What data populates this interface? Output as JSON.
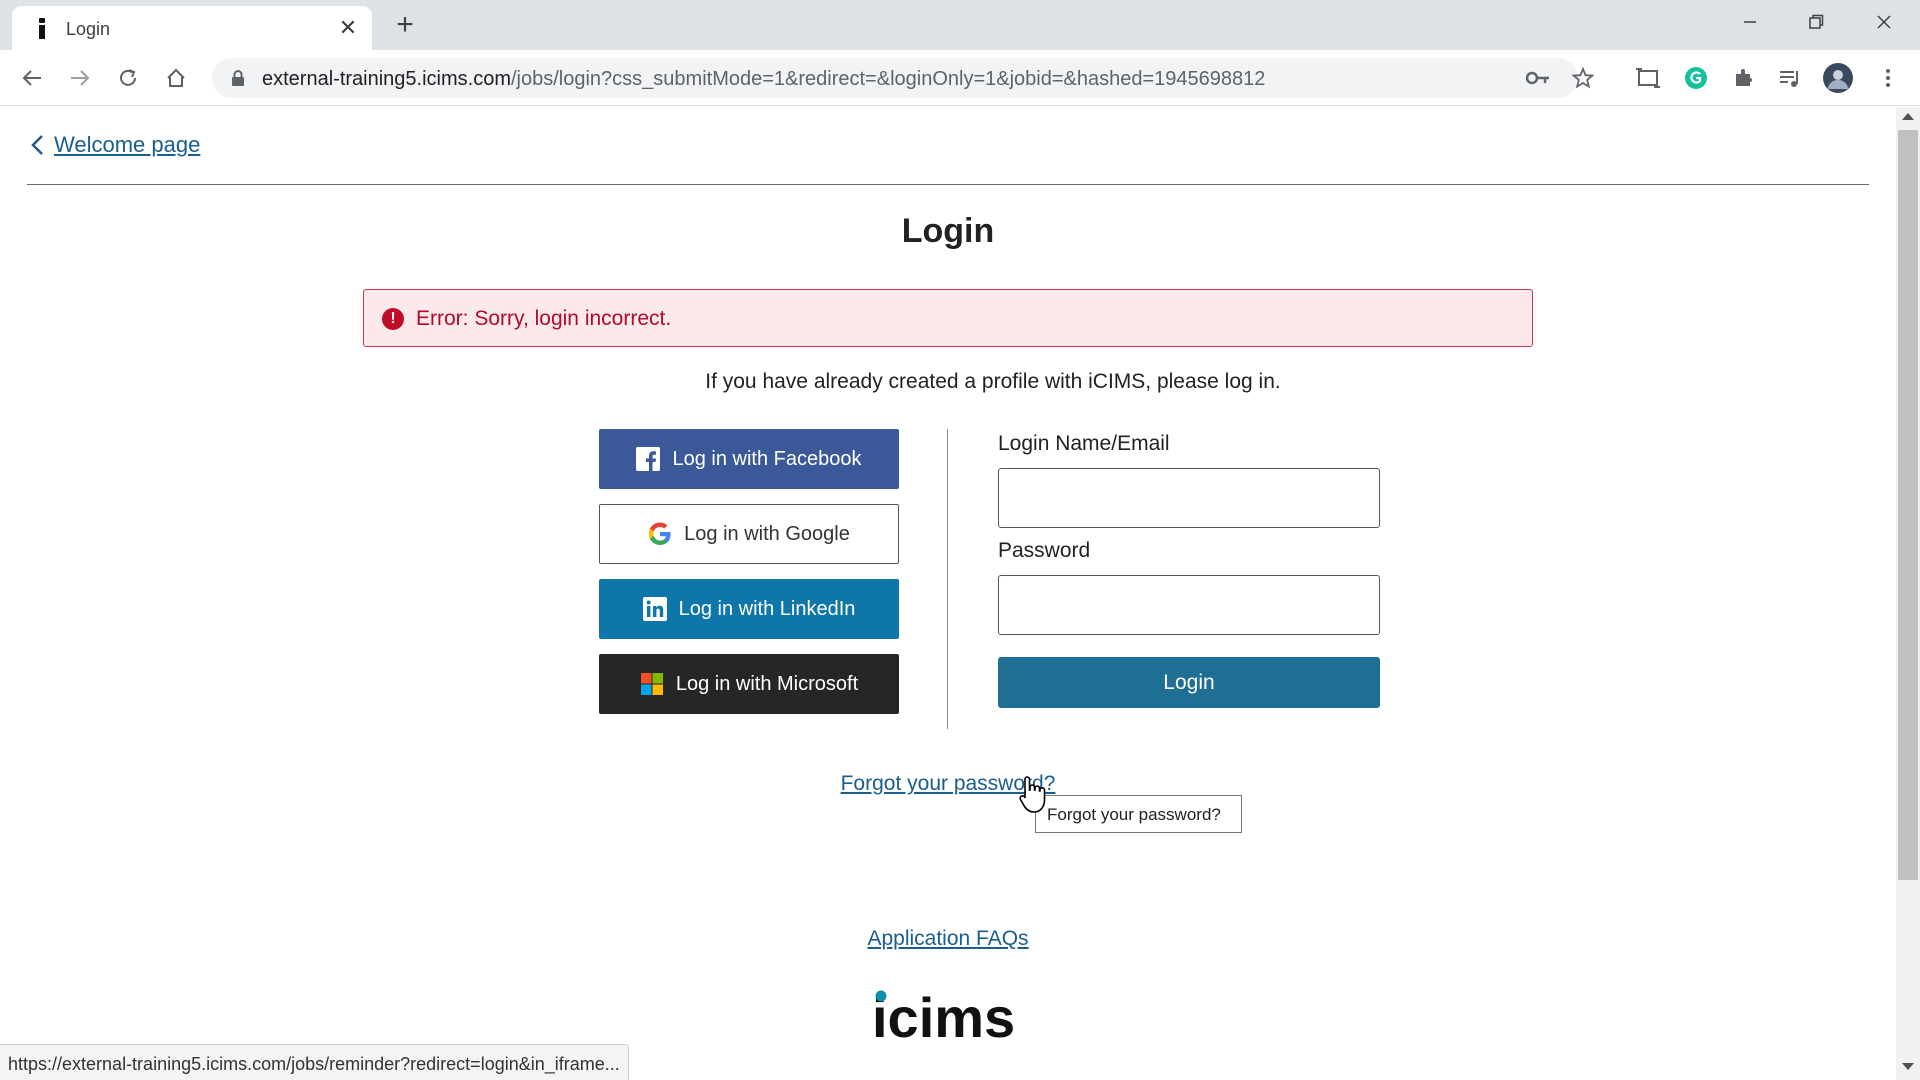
{
  "browser": {
    "tab_title": "Login",
    "url_host": "external-training5.icims.com",
    "url_path": "/jobs/login?css_submitMode=1&redirect=&loginOnly=1&jobid=&hashed=1945698812",
    "status_url": "https://external-training5.icims.com/jobs/reminder?redirect=login&in_iframe...",
    "icons": [
      "back-icon",
      "forward-icon",
      "reload-icon",
      "home-icon",
      "lock-icon",
      "key-icon",
      "star-icon",
      "cast-icon",
      "grammarly-icon",
      "extensions-icon",
      "media-icon",
      "profile-avatar",
      "kebab-menu-icon"
    ]
  },
  "page": {
    "back_link": "Welcome page",
    "title": "Login",
    "error": "Error: Sorry, login incorrect.",
    "intro": "If you have already created a profile with iCIMS, please log in.",
    "social": {
      "facebook": "Log in with Facebook",
      "google": "Log in with Google",
      "linkedin": "Log in with LinkedIn",
      "microsoft": "Log in with Microsoft"
    },
    "form": {
      "login_label": "Login Name/Email",
      "login_value": "",
      "password_label": "Password",
      "password_value": "",
      "submit": "Login"
    },
    "forgot": "Forgot your password?",
    "tooltip": "Forgot your password?",
    "faq": "Application FAQs",
    "logo_text": "icims"
  },
  "colors": {
    "link": "#1a5d8f",
    "error_bg": "#fbe9ec",
    "error_text": "#b3092a",
    "facebook": "#3b5998",
    "linkedin": "#0e76a8",
    "microsoft": "#262626",
    "login_button": "#1f6e93"
  }
}
